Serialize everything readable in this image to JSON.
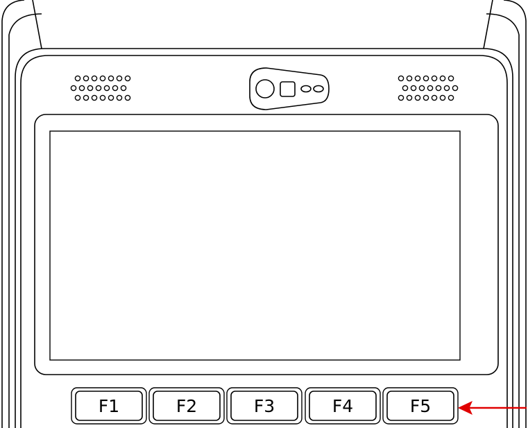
{
  "keys": [
    {
      "label": "F1"
    },
    {
      "label": "F2"
    },
    {
      "label": "F3"
    },
    {
      "label": "F4"
    },
    {
      "label": "F5"
    }
  ],
  "icons": {
    "camera": "camera-icon",
    "speaker_left": "speaker-grille-icon",
    "speaker_right": "speaker-grille-icon",
    "arrow": "arrow-left-icon"
  },
  "colors": {
    "outline": "#000000",
    "background": "#ffffff",
    "arrow": "#e00000"
  }
}
